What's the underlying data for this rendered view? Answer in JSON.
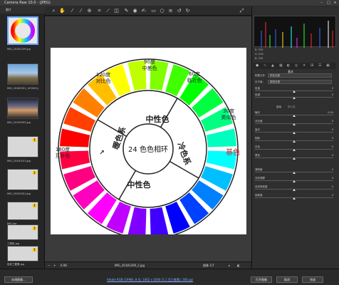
{
  "window": {
    "title": "Camera Raw 10.0 - (JPEG)"
  },
  "filmstrip": {
    "header": "胶片",
    "items": [
      {
        "label": "IMG_20181209.jpg",
        "warn": false
      },
      {
        "label": "IMG_20180501_143045.jpg",
        "warn": false
      },
      {
        "label": "IMG_20190903.jpg",
        "warn": false
      },
      {
        "label": "IMG_20200101.jpg",
        "warn": true
      },
      {
        "label": "IMG_20200301.jpg",
        "warn": true
      },
      {
        "label": "IMG.jpg",
        "warn": true
      },
      {
        "label": "三原色.jpg",
        "warn": true
      },
      {
        "label": "色彩三要素.jpg",
        "warn": true
      }
    ]
  },
  "photo": {
    "center_label": "24 色色相环",
    "segments": [
      "中性色",
      "冷色系",
      "中性色",
      "暖色系"
    ],
    "arrow_glyph": "↗",
    "angles": [
      {
        "text1": "90度",
        "text2": "中差色"
      },
      {
        "text1": "60度",
        "text2": "临近色"
      },
      {
        "text1": "120度",
        "text2": "对比色"
      },
      {
        "text1": "30度",
        "text2": "类似色"
      },
      {
        "text1": "180度",
        "text2": "互补色"
      }
    ],
    "base_label": "基色"
  },
  "status": {
    "zoom": "6.96",
    "filename": "IMG_20181209_2.jpg",
    "nav_label": "图像 1/7"
  },
  "histogram": {
    "r": "R: 255",
    "g": "G: 255",
    "b": "B: 255"
  },
  "panel": {
    "section_title": "基本",
    "profile_label": "配置文件:",
    "profile_value": "颜色设置",
    "wb_label": "白平衡:",
    "wb_value": "原照设置",
    "auto_label": "自动",
    "default_label": "默认值",
    "sliders": [
      {
        "name": "色温",
        "value": "0",
        "pos": 0.5
      },
      {
        "name": "色调",
        "value": "0",
        "pos": 0.5
      },
      {
        "name": "曝光",
        "value": "0.00",
        "pos": 0.5
      },
      {
        "name": "对比度",
        "value": "0",
        "pos": 0.5
      },
      {
        "name": "高光",
        "value": "0",
        "pos": 0.5
      },
      {
        "name": "阴影",
        "value": "0",
        "pos": 0.5
      },
      {
        "name": "白色",
        "value": "0",
        "pos": 0.5
      },
      {
        "name": "黑色",
        "value": "0",
        "pos": 0.5
      },
      {
        "name": "清晰度",
        "value": "0",
        "pos": 0.5
      },
      {
        "name": "去除薄雾",
        "value": "0",
        "pos": 0.5
      },
      {
        "name": "自然饱和度",
        "value": "0",
        "pos": 0.5
      },
      {
        "name": "饱和度",
        "value": "0",
        "pos": 0.5
      }
    ]
  },
  "bottombar": {
    "save_label": "存储图像...",
    "info_text": "Adobe RGB (1998); 8 位; 1062 x 1000 (1.1 百万像素); 300 ppi",
    "open_label": "打开图像",
    "cancel_label": "取消",
    "done_label": "完成"
  }
}
